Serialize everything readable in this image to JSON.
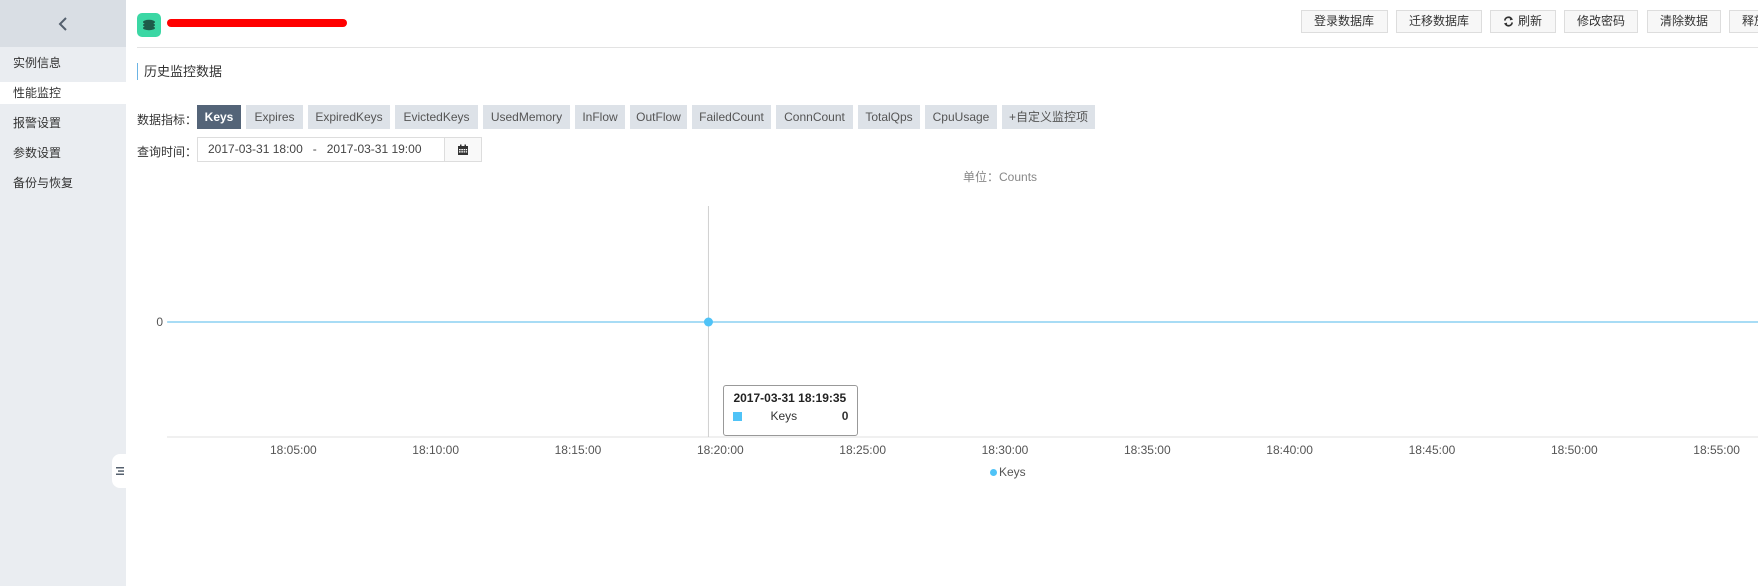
{
  "sidebar": {
    "back_icon": "chevron-left-icon",
    "items": [
      {
        "label": "实例信息",
        "active": false
      },
      {
        "label": "性能监控",
        "active": true
      },
      {
        "label": "报警设置",
        "active": false
      },
      {
        "label": "参数设置",
        "active": false
      },
      {
        "label": "备份与恢复",
        "active": false
      }
    ],
    "collapse_icon": "list-collapse-icon"
  },
  "header": {
    "title": "[redacted]",
    "logo_icon": "database-stack-icon",
    "buttons": [
      {
        "label": "登录数据库"
      },
      {
        "label": "迁移数据库"
      },
      {
        "label": "刷新",
        "icon": "refresh-icon"
      },
      {
        "label": "修改密码"
      },
      {
        "label": "清除数据"
      },
      {
        "label": "释放"
      }
    ]
  },
  "section_title": "历史监控数据",
  "metrics": {
    "label": "数据指标：",
    "tabs": [
      {
        "label": "Keys",
        "active": true
      },
      {
        "label": "Expires"
      },
      {
        "label": "ExpiredKeys"
      },
      {
        "label": "EvictedKeys"
      },
      {
        "label": "UsedMemory"
      },
      {
        "label": "InFlow"
      },
      {
        "label": "OutFlow"
      },
      {
        "label": "FailedCount"
      },
      {
        "label": "ConnCount"
      },
      {
        "label": "TotalQps"
      },
      {
        "label": "CpuUsage"
      },
      {
        "label": "+自定义监控项"
      }
    ]
  },
  "query": {
    "label": "查询时间：",
    "range": "2017-03-31 18:00   -   2017-03-31 19:00",
    "calendar_icon": "calendar-icon"
  },
  "colors": {
    "series": "#4fc3f7",
    "line": "#a8dcf5",
    "active_tab": "#546478",
    "tab": "#dde2e8"
  },
  "chart_data": {
    "type": "line",
    "unit_label": "单位：Counts",
    "title": "",
    "xlabel": "",
    "ylabel": "",
    "x_ticks": [
      "18:05:00",
      "18:10:00",
      "18:15:00",
      "18:20:00",
      "18:25:00",
      "18:30:00",
      "18:35:00",
      "18:40:00",
      "18:45:00",
      "18:50:00",
      "18:55:00"
    ],
    "x_range": [
      "18:00:34",
      "19:00:00"
    ],
    "y_ticks": [
      "0"
    ],
    "series": [
      {
        "name": "Keys",
        "points": [
          {
            "x": "18:00:34",
            "y": 0
          },
          {
            "x": "18:19:35",
            "y": 0
          },
          {
            "x": "19:00:00",
            "y": 0
          }
        ]
      }
    ],
    "highlighted_point": {
      "x": "18:19:35",
      "y": 0
    },
    "tooltip": {
      "title": "2017-03-31 18:19:35",
      "series": "Keys",
      "value": "0"
    },
    "legend": [
      {
        "name": "Keys"
      }
    ],
    "legend_position": "bottom-center",
    "grid": false
  }
}
